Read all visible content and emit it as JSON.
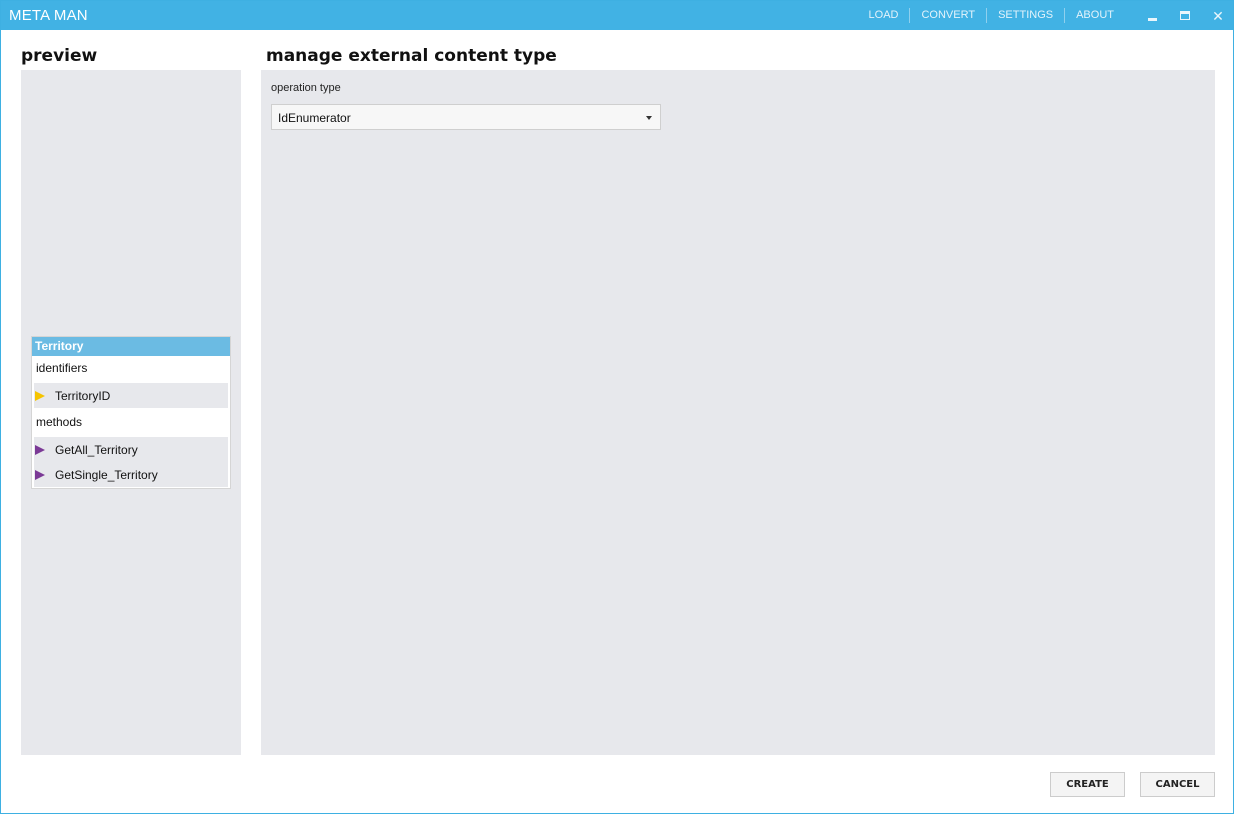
{
  "window": {
    "title": "META MAN",
    "nav": [
      "LOAD",
      "CONVERT",
      "SETTINGS",
      "ABOUT"
    ],
    "controls": {
      "minimize": "minimize-icon",
      "maximize": "maximize-icon",
      "close": "✕"
    },
    "accent_color": "#41b2e4"
  },
  "preview": {
    "heading": "preview",
    "entity": {
      "name": "Territory",
      "identifiers_label": "identifiers",
      "identifiers": [
        {
          "label": "TerritoryID",
          "icon": "identifier-icon",
          "color": "#f5c400"
        }
      ],
      "methods_label": "methods",
      "methods": [
        {
          "label": "GetAll_Territory",
          "icon": "method-icon",
          "color": "#7b3a96"
        },
        {
          "label": "GetSingle_Territory",
          "icon": "method-icon",
          "color": "#7b3a96"
        }
      ]
    }
  },
  "main": {
    "heading": "manage external content type",
    "operation_type_label": "operation type",
    "operation_type_value": "IdEnumerator"
  },
  "footer": {
    "create_label": "CREATE",
    "cancel_label": "CANCEL"
  }
}
